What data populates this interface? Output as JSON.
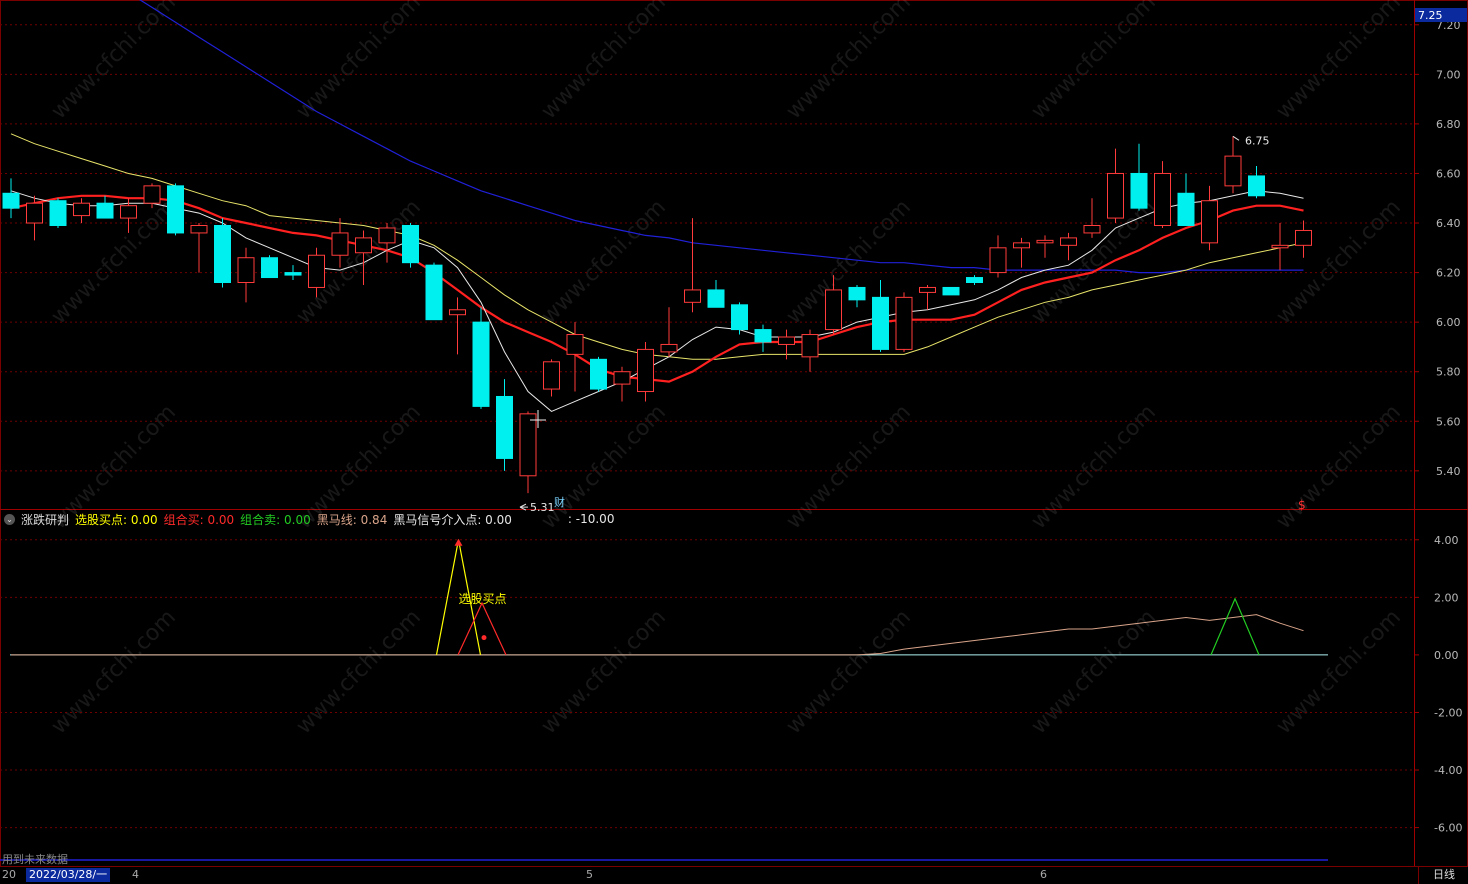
{
  "price_axis": {
    "top_label": "7.25",
    "ticks": [
      "7.20",
      "7.00",
      "6.80",
      "6.60",
      "6.40",
      "6.20",
      "6.00",
      "5.80",
      "5.60",
      "5.40"
    ]
  },
  "indicator_axis": {
    "ticks": [
      "4.00",
      "2.00",
      "0.00",
      "-2.00",
      "-4.00",
      "-6.00"
    ]
  },
  "annotations": {
    "high": "6.75",
    "low": "5.31",
    "finance_marker": "财",
    "dividend_marker": "$",
    "buy_signal": "选股买点"
  },
  "indicator": {
    "name": "涨跌研判",
    "items": [
      {
        "label": "选股买点:",
        "value": "0.00",
        "color": "#ffff00"
      },
      {
        "label": "组合买:",
        "value": "0.00",
        "color": "#ff2a2a"
      },
      {
        "label": "组合卖:",
        "value": "0.00",
        "color": "#22cc22"
      },
      {
        "label": "黑马线:",
        "value": "0.84",
        "color": "#d9a48a"
      },
      {
        "label": "黑马信号介入点:",
        "value": "0.00",
        "color": "#e6e6e6"
      }
    ],
    "extra": ": -10.00"
  },
  "footer": {
    "future_note": "用到未来数据",
    "date_prefix": "20",
    "date": "2022/03/28/一",
    "months": [
      "4",
      "5",
      "6"
    ],
    "period": "日线"
  },
  "watermark": "www.cfchi.com",
  "colors": {
    "up": "#ff3b3b",
    "down": "#00f0f0",
    "ma_white": "#e8e8e8",
    "ma_red": "#ff2020",
    "ma_yellow": "#e8e46a",
    "ma_blue": "#2020d8"
  },
  "chart_data": {
    "type": "candlestick",
    "title": "",
    "ylim": [
      5.25,
      7.3
    ],
    "candles": [
      {
        "o": 6.52,
        "h": 6.58,
        "l": 6.42,
        "c": 6.46
      },
      {
        "o": 6.4,
        "h": 6.51,
        "l": 6.33,
        "c": 6.48
      },
      {
        "o": 6.49,
        "h": 6.5,
        "l": 6.38,
        "c": 6.39
      },
      {
        "o": 6.43,
        "h": 6.5,
        "l": 6.4,
        "c": 6.48
      },
      {
        "o": 6.48,
        "h": 6.51,
        "l": 6.42,
        "c": 6.42
      },
      {
        "o": 6.42,
        "h": 6.5,
        "l": 6.36,
        "c": 6.47
      },
      {
        "o": 6.48,
        "h": 6.56,
        "l": 6.46,
        "c": 6.55
      },
      {
        "o": 6.55,
        "h": 6.56,
        "l": 6.35,
        "c": 6.36
      },
      {
        "o": 6.36,
        "h": 6.4,
        "l": 6.2,
        "c": 6.39
      },
      {
        "o": 6.39,
        "h": 6.42,
        "l": 6.14,
        "c": 6.16
      },
      {
        "o": 6.16,
        "h": 6.3,
        "l": 6.08,
        "c": 6.26
      },
      {
        "o": 6.26,
        "h": 6.27,
        "l": 6.18,
        "c": 6.18
      },
      {
        "o": 6.2,
        "h": 6.23,
        "l": 6.17,
        "c": 6.19
      },
      {
        "o": 6.14,
        "h": 6.3,
        "l": 6.1,
        "c": 6.27
      },
      {
        "o": 6.27,
        "h": 6.42,
        "l": 6.22,
        "c": 6.36
      },
      {
        "o": 6.28,
        "h": 6.37,
        "l": 6.15,
        "c": 6.34
      },
      {
        "o": 6.32,
        "h": 6.4,
        "l": 6.24,
        "c": 6.38
      },
      {
        "o": 6.39,
        "h": 6.4,
        "l": 6.22,
        "c": 6.24
      },
      {
        "o": 6.23,
        "h": 6.24,
        "l": 6.01,
        "c": 6.01
      },
      {
        "o": 6.03,
        "h": 6.1,
        "l": 5.87,
        "c": 6.05
      },
      {
        "o": 6.0,
        "h": 6.06,
        "l": 5.65,
        "c": 5.66
      },
      {
        "o": 5.7,
        "h": 5.77,
        "l": 5.4,
        "c": 5.45
      },
      {
        "o": 5.38,
        "h": 5.64,
        "l": 5.31,
        "c": 5.63
      },
      {
        "o": 5.73,
        "h": 5.85,
        "l": 5.7,
        "c": 5.84
      },
      {
        "o": 5.87,
        "h": 6.0,
        "l": 5.72,
        "c": 5.95
      },
      {
        "o": 5.85,
        "h": 5.86,
        "l": 5.72,
        "c": 5.73
      },
      {
        "o": 5.75,
        "h": 5.82,
        "l": 5.68,
        "c": 5.8
      },
      {
        "o": 5.72,
        "h": 5.92,
        "l": 5.68,
        "c": 5.89
      },
      {
        "o": 5.88,
        "h": 6.06,
        "l": 5.86,
        "c": 5.91
      },
      {
        "o": 6.08,
        "h": 6.42,
        "l": 6.04,
        "c": 6.13
      },
      {
        "o": 6.13,
        "h": 6.17,
        "l": 6.06,
        "c": 6.06
      },
      {
        "o": 6.07,
        "h": 6.08,
        "l": 5.95,
        "c": 5.97
      },
      {
        "o": 5.97,
        "h": 5.99,
        "l": 5.88,
        "c": 5.92
      },
      {
        "o": 5.91,
        "h": 5.97,
        "l": 5.85,
        "c": 5.94
      },
      {
        "o": 5.86,
        "h": 5.97,
        "l": 5.8,
        "c": 5.95
      },
      {
        "o": 5.97,
        "h": 6.19,
        "l": 5.95,
        "c": 6.13
      },
      {
        "o": 6.14,
        "h": 6.15,
        "l": 6.06,
        "c": 6.09
      },
      {
        "o": 6.1,
        "h": 6.17,
        "l": 5.88,
        "c": 5.89
      },
      {
        "o": 5.89,
        "h": 6.12,
        "l": 5.88,
        "c": 6.1
      },
      {
        "o": 6.12,
        "h": 6.15,
        "l": 6.05,
        "c": 6.14
      },
      {
        "o": 6.14,
        "h": 6.14,
        "l": 6.11,
        "c": 6.11
      },
      {
        "o": 6.18,
        "h": 6.19,
        "l": 6.15,
        "c": 6.16
      },
      {
        "o": 6.2,
        "h": 6.35,
        "l": 6.18,
        "c": 6.3
      },
      {
        "o": 6.3,
        "h": 6.34,
        "l": 6.22,
        "c": 6.32
      },
      {
        "o": 6.32,
        "h": 6.35,
        "l": 6.26,
        "c": 6.33
      },
      {
        "o": 6.31,
        "h": 6.36,
        "l": 6.25,
        "c": 6.34
      },
      {
        "o": 6.36,
        "h": 6.5,
        "l": 6.34,
        "c": 6.39
      },
      {
        "o": 6.42,
        "h": 6.7,
        "l": 6.4,
        "c": 6.6
      },
      {
        "o": 6.6,
        "h": 6.72,
        "l": 6.45,
        "c": 6.46
      },
      {
        "o": 6.39,
        "h": 6.65,
        "l": 6.38,
        "c": 6.6
      },
      {
        "o": 6.52,
        "h": 6.6,
        "l": 6.39,
        "c": 6.39
      },
      {
        "o": 6.32,
        "h": 6.55,
        "l": 6.29,
        "c": 6.49
      },
      {
        "o": 6.55,
        "h": 6.75,
        "l": 6.52,
        "c": 6.67
      },
      {
        "o": 6.59,
        "h": 6.63,
        "l": 6.5,
        "c": 6.51
      },
      {
        "o": 6.3,
        "h": 6.4,
        "l": 6.21,
        "c": 6.31
      },
      {
        "o": 6.31,
        "h": 6.41,
        "l": 6.26,
        "c": 6.37
      }
    ],
    "ma_white": [
      6.53,
      6.5,
      6.48,
      6.47,
      6.47,
      6.48,
      6.48,
      6.46,
      6.44,
      6.4,
      6.34,
      6.3,
      6.26,
      6.22,
      6.21,
      6.24,
      6.29,
      6.33,
      6.3,
      6.22,
      6.08,
      5.88,
      5.72,
      5.64,
      5.68,
      5.72,
      5.76,
      5.81,
      5.86,
      5.93,
      5.98,
      5.97,
      5.94,
      5.94,
      5.94,
      5.96,
      6.0,
      6.02,
      6.04,
      6.05,
      6.07,
      6.09,
      6.13,
      6.18,
      6.21,
      6.23,
      6.29,
      6.38,
      6.42,
      6.46,
      6.48,
      6.49,
      6.51,
      6.53,
      6.52,
      6.5
    ],
    "ma_red": [
      6.46,
      6.48,
      6.5,
      6.51,
      6.51,
      6.5,
      6.5,
      6.49,
      6.46,
      6.42,
      6.4,
      6.38,
      6.36,
      6.35,
      6.33,
      6.31,
      6.29,
      6.26,
      6.2,
      6.13,
      6.06,
      6.0,
      5.96,
      5.92,
      5.87,
      5.81,
      5.78,
      5.77,
      5.76,
      5.8,
      5.86,
      5.91,
      5.92,
      5.92,
      5.92,
      5.95,
      5.98,
      6.0,
      6.01,
      6.01,
      6.01,
      6.03,
      6.08,
      6.13,
      6.16,
      6.18,
      6.2,
      6.25,
      6.29,
      6.34,
      6.38,
      6.41,
      6.45,
      6.47,
      6.47,
      6.45
    ],
    "ma_yellow": [
      6.76,
      6.72,
      6.69,
      6.66,
      6.63,
      6.6,
      6.58,
      6.55,
      6.52,
      6.49,
      6.47,
      6.43,
      6.42,
      6.41,
      6.4,
      6.39,
      6.37,
      6.35,
      6.31,
      6.25,
      6.18,
      6.11,
      6.05,
      6.0,
      5.95,
      5.92,
      5.89,
      5.87,
      5.86,
      5.85,
      5.85,
      5.86,
      5.87,
      5.87,
      5.87,
      5.87,
      5.87,
      5.87,
      5.87,
      5.9,
      5.94,
      5.98,
      6.02,
      6.05,
      6.08,
      6.1,
      6.13,
      6.15,
      6.17,
      6.19,
      6.21,
      6.24,
      6.26,
      6.28,
      6.3,
      6.32
    ],
    "ma_blue": [
      7.66,
      7.59,
      7.53,
      7.46,
      7.4,
      7.33,
      7.27,
      7.21,
      7.15,
      7.09,
      7.03,
      6.97,
      6.91,
      6.85,
      6.8,
      6.75,
      6.7,
      6.65,
      6.61,
      6.57,
      6.53,
      6.5,
      6.47,
      6.44,
      6.41,
      6.39,
      6.37,
      6.35,
      6.34,
      6.32,
      6.31,
      6.3,
      6.29,
      6.28,
      6.27,
      6.26,
      6.25,
      6.24,
      6.24,
      6.23,
      6.22,
      6.22,
      6.21,
      6.21,
      6.21,
      6.21,
      6.21,
      6.21,
      6.2,
      6.2,
      6.21,
      6.21,
      6.21,
      6.21,
      6.21,
      6.21
    ],
    "indicator": {
      "ylim": [
        -7.3,
        5.0
      ],
      "heima_line": [
        0,
        0,
        0,
        0,
        0,
        0,
        0,
        0,
        0,
        0,
        0,
        0,
        0,
        0,
        0,
        0,
        0,
        0,
        0,
        0,
        0,
        0,
        0,
        0,
        0,
        0,
        0,
        0,
        0,
        0,
        0,
        0,
        0,
        0,
        0,
        0,
        0,
        0.05,
        0.2,
        0.3,
        0.4,
        0.5,
        0.6,
        0.7,
        0.8,
        0.9,
        0.9,
        1.0,
        1.1,
        1.2,
        1.3,
        1.2,
        1.3,
        1.4,
        1.1,
        0.84
      ],
      "buy_point_peak_index": 19,
      "combo_buy_peak_index": 20,
      "combo_sell_peak_index": 52,
      "heima_signal_dot_index": 20
    }
  }
}
